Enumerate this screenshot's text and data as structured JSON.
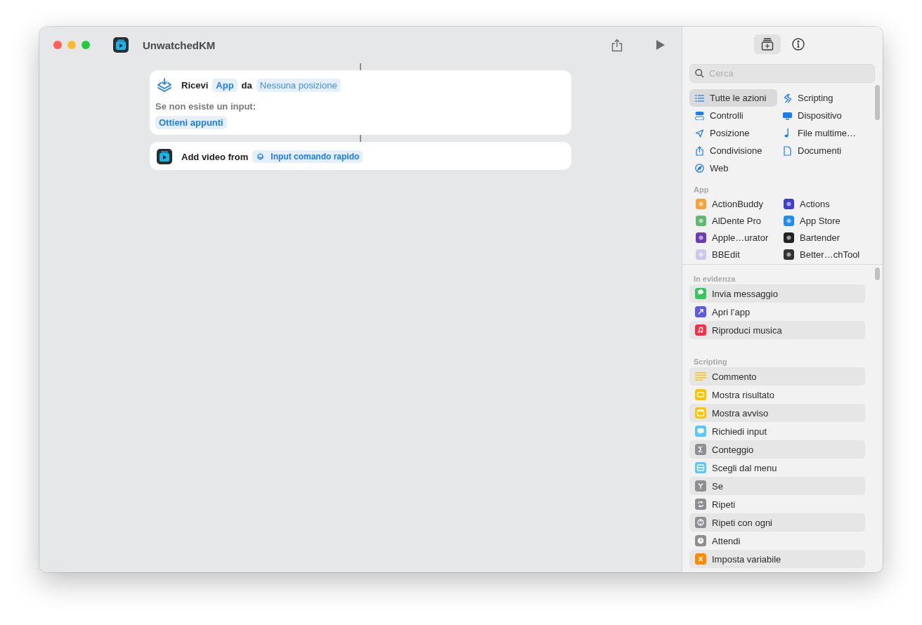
{
  "window": {
    "title": "UnwatchedKM"
  },
  "actions": [
    {
      "kind": "receive",
      "parts": [
        {
          "kind": "text",
          "text": "Ricevi"
        },
        {
          "kind": "token",
          "text": "App"
        },
        {
          "kind": "text",
          "text": "da"
        },
        {
          "kind": "placeholder",
          "text": "Nessuna posizione"
        }
      ],
      "fallback_label": "Se non esiste un input:",
      "fallback_token": "Ottieni appunti"
    },
    {
      "kind": "app",
      "parts": [
        {
          "kind": "text",
          "text": "Add video from"
        },
        {
          "kind": "variable",
          "text": "Input comando rapido"
        }
      ]
    }
  ],
  "sidebar": {
    "tabs": [
      {
        "kind": "library",
        "selected": true
      },
      {
        "kind": "info",
        "selected": false
      }
    ],
    "search": {
      "placeholder": "Cerca"
    },
    "categories": [
      {
        "label": "Tutte le azioni",
        "selected": true
      },
      {
        "label": "Scripting",
        "selected": false
      },
      {
        "label": "Controlli",
        "selected": false
      },
      {
        "label": "Dispositivo",
        "selected": false
      },
      {
        "label": "Posizione",
        "selected": false
      },
      {
        "label": "File multime…",
        "selected": false
      },
      {
        "label": "Condivisione",
        "selected": false
      },
      {
        "label": "Documenti",
        "selected": false
      },
      {
        "label": "Web",
        "selected": false
      }
    ],
    "apps_header": "App",
    "apps": [
      {
        "label": "ActionBuddy",
        "color": "#f2a33a"
      },
      {
        "label": "Actions",
        "color": "#3d3fd0"
      },
      {
        "label": "AlDente Pro",
        "color": "#5fb870"
      },
      {
        "label": "App Store",
        "color": "#1d8cf4"
      },
      {
        "label": "Apple…urator",
        "color": "#6a3db3"
      },
      {
        "label": "Bartender",
        "color": "#222222"
      },
      {
        "label": "BBEdit",
        "color": "#c9c9ea"
      },
      {
        "label": "Better…chTool",
        "color": "#333333"
      }
    ],
    "featured": {
      "header": "In evidenza",
      "items": [
        {
          "label": "Invia messaggio",
          "color": "#34c759"
        },
        {
          "label": "Apri l’app",
          "color": "#5e5ce6"
        },
        {
          "label": "Riproduci musica",
          "color": "#fa2d48"
        }
      ]
    },
    "scripting": {
      "header": "Scripting",
      "items": [
        {
          "label": "Commento",
          "color": "#f7c325"
        },
        {
          "label": "Mostra risultato",
          "color": "#ffc400"
        },
        {
          "label": "Mostra avviso",
          "color": "#ffc400"
        },
        {
          "label": "Richiedi input",
          "color": "#5ac8fa"
        },
        {
          "label": "Conteggio",
          "color": "#8e8e93"
        },
        {
          "label": "Scegli dal menu",
          "color": "#5ac8fa"
        },
        {
          "label": "Se",
          "color": "#8e8e93"
        },
        {
          "label": "Ripeti",
          "color": "#8e8e93"
        },
        {
          "label": "Ripeti con ogni",
          "color": "#8e8e93"
        },
        {
          "label": "Attendi",
          "color": "#8e8e93"
        },
        {
          "label": "Imposta variabile",
          "color": "#ff8a00"
        }
      ]
    }
  }
}
